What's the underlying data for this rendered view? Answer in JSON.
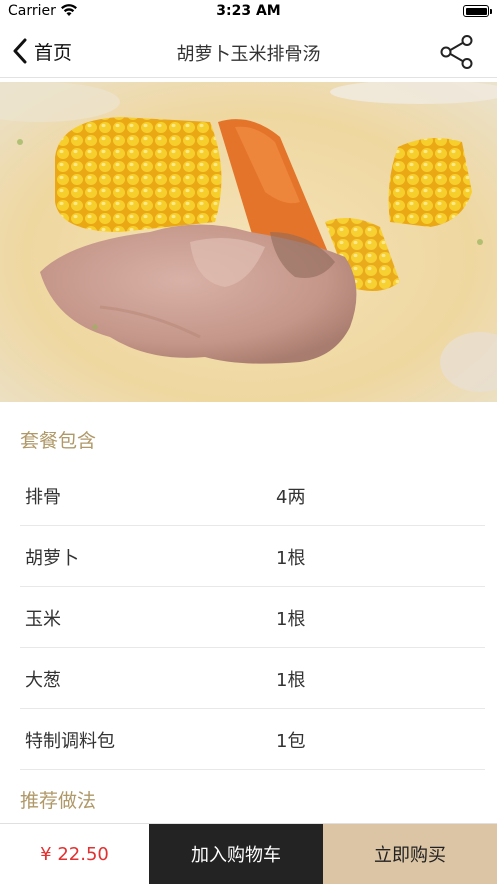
{
  "status_bar": {
    "carrier": "Carrier",
    "time": "3:23 AM"
  },
  "nav": {
    "back_label": "首页",
    "title": "胡萝卜玉米排骨汤"
  },
  "icons": {
    "back": "chevron-left-icon",
    "share": "share-icon",
    "wifi": "wifi-icon",
    "battery": "battery-icon"
  },
  "package": {
    "title": "套餐包含",
    "items": [
      {
        "name": "排骨",
        "qty": "4两"
      },
      {
        "name": "胡萝卜",
        "qty": "1根"
      },
      {
        "name": "玉米",
        "qty": "1根"
      },
      {
        "name": "大葱",
        "qty": "1根"
      },
      {
        "name": "特制调料包",
        "qty": "1包"
      }
    ]
  },
  "recipe": {
    "title": "推荐做法"
  },
  "bottom": {
    "price": "¥ 22.50",
    "add_to_cart": "加入购物车",
    "buy_now": "立即购买"
  },
  "colors": {
    "accent": "#b09968",
    "price": "#e33030",
    "cart_bg": "#232323",
    "buy_bg": "#dcc5a5"
  }
}
